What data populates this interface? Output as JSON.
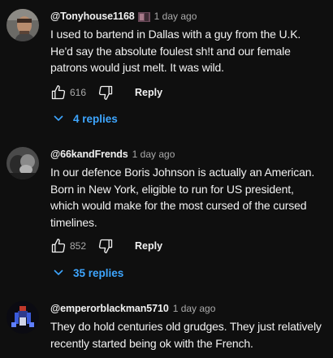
{
  "colors": {
    "background": "#0f0f0f",
    "text_primary": "#f1f1f1",
    "text_secondary": "#aaaaaa",
    "link_blue": "#3ea6ff"
  },
  "comments": [
    {
      "username": "@Tonyhouse1168",
      "timestamp": "1 day ago",
      "lines": [
        "I used to bartend in Dallas with a guy from the U.K.",
        "He'd say the absolute foulest sh!t and our female",
        "patrons would just melt. It was wild."
      ],
      "like_count": "616",
      "reply_label": "Reply",
      "replies_label": "4 replies"
    },
    {
      "username": "@66kandFrends",
      "timestamp": "1 day ago",
      "lines": [
        "In our defence Boris Johnson is actually an American.",
        "Born in New York, eligible to run for US president,",
        "which would make for the most cursed of the cursed",
        "timelines."
      ],
      "like_count": "852",
      "reply_label": "Reply",
      "replies_label": "35 replies"
    },
    {
      "username": "@emperorblackman5710",
      "timestamp": "1 day ago",
      "lines": [
        "They do hold centuries old grudges. They just relatively",
        "recently started being ok with the French."
      ]
    }
  ]
}
